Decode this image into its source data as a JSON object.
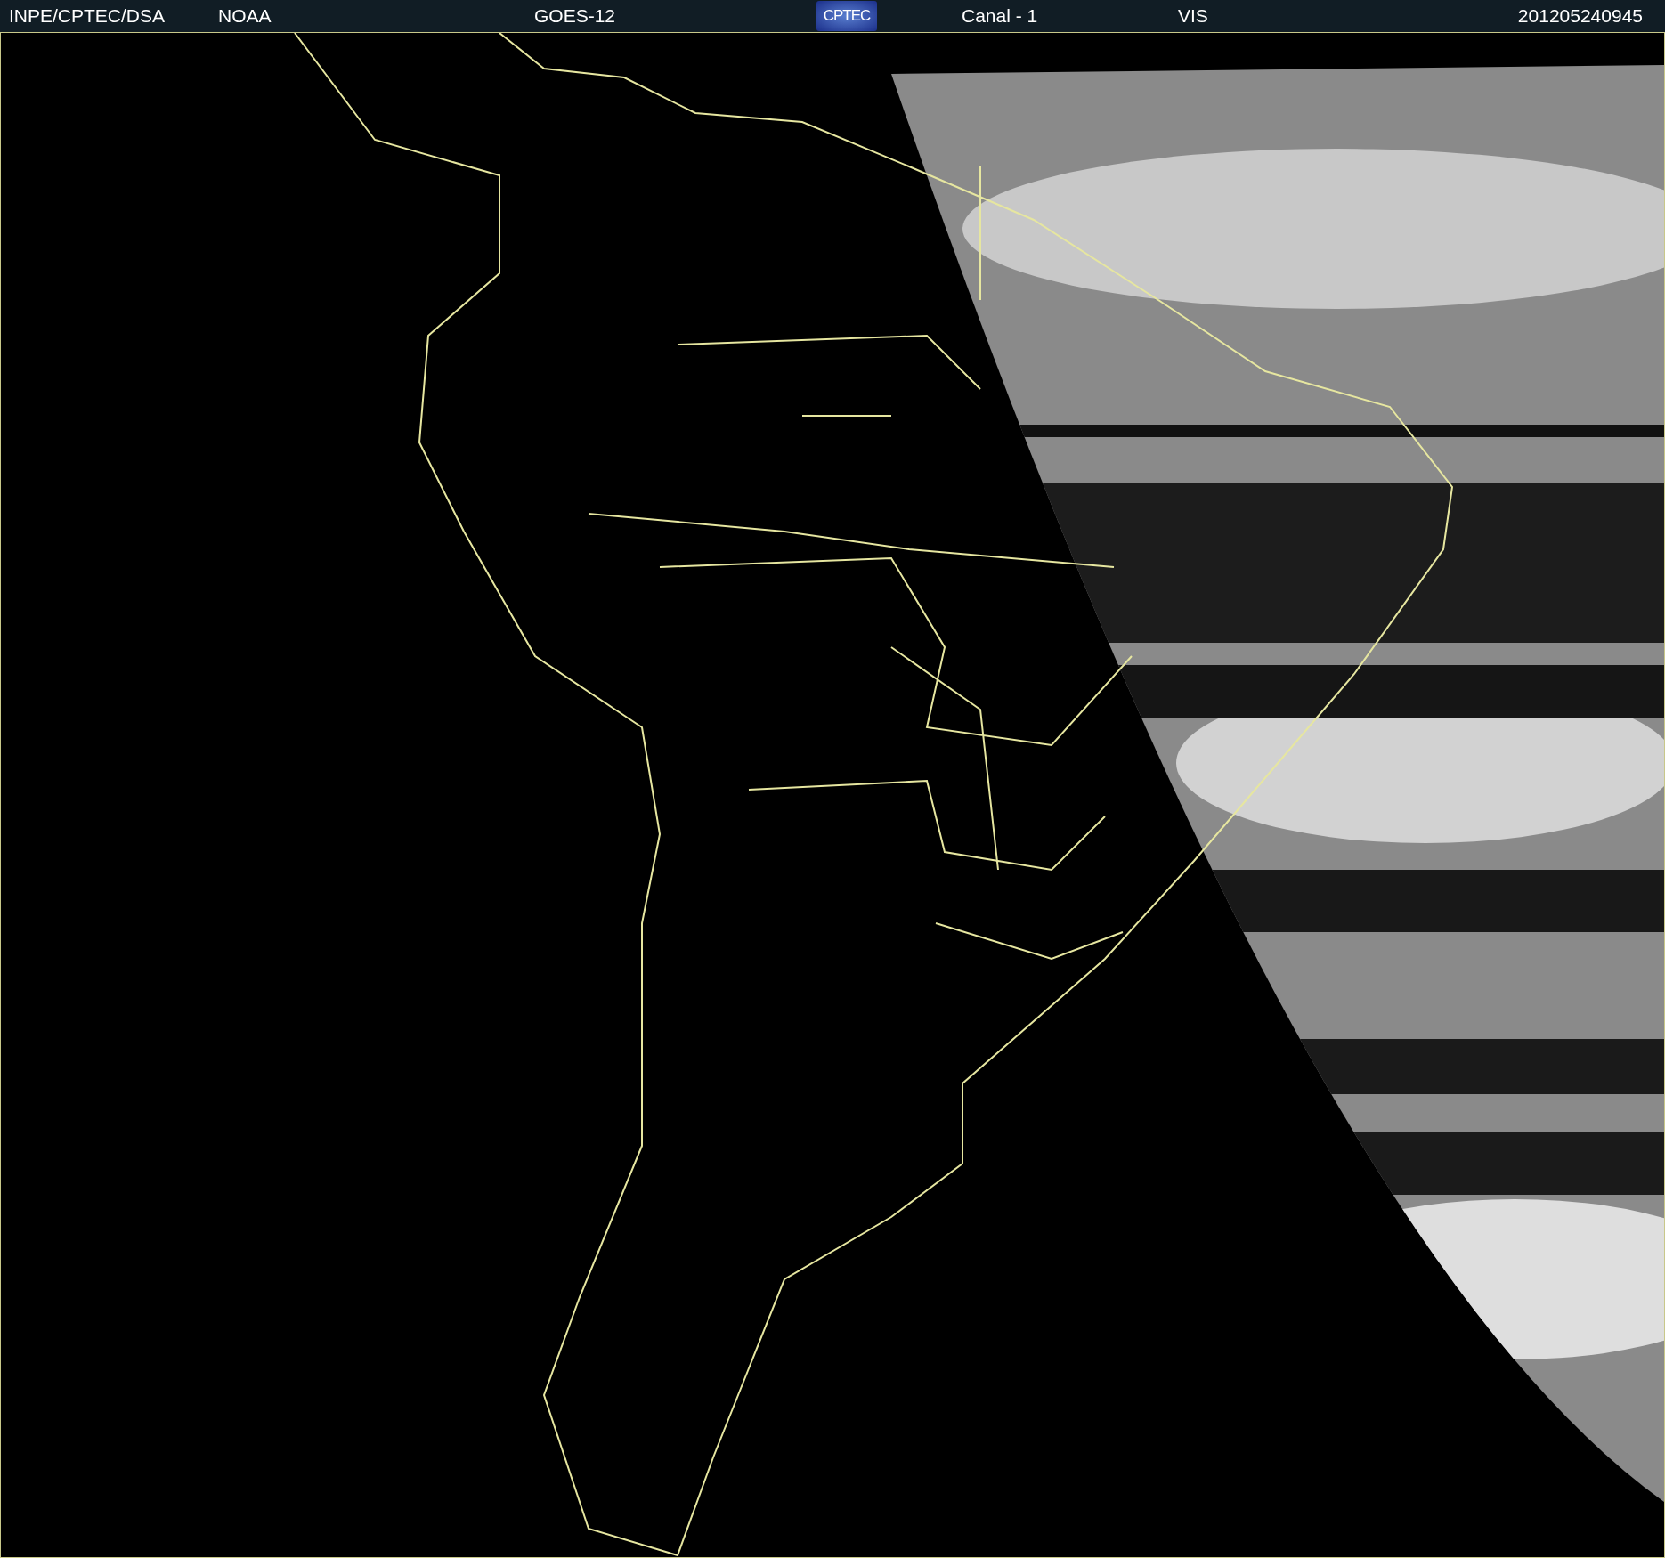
{
  "header": {
    "items": [
      {
        "kind": "text",
        "label": "INPE/CPTEC/DSA"
      },
      {
        "kind": "text",
        "label": "NOAA"
      },
      {
        "kind": "text",
        "label": "GOES-12"
      },
      {
        "kind": "logo",
        "label": "CPTEC"
      },
      {
        "kind": "text",
        "label": "Canal - 1"
      },
      {
        "kind": "text",
        "label": "VIS"
      },
      {
        "kind": "text",
        "label": "201205240945"
      }
    ]
  }
}
